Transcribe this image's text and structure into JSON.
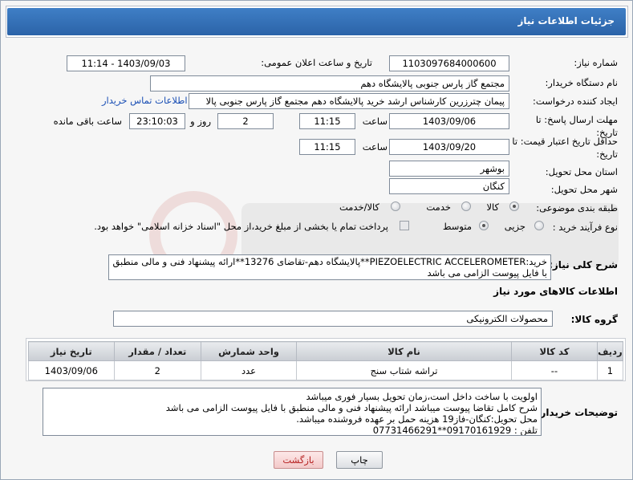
{
  "header": {
    "title": "جزئیات اطلاعات نیاز"
  },
  "labels": {
    "need_number": "شماره نیاز:",
    "announce_datetime": "تاریخ و ساعت اعلان عمومی:",
    "buyer_org": "نام دستگاه خریدار:",
    "requester": "ایجاد کننده درخواست:",
    "reply_deadline": "مهلت ارسال پاسخ: تا تاریخ:",
    "hour": "ساعت",
    "day_and": "روز و",
    "remaining": "ساعت باقی مانده",
    "price_validity": "حداقل تاریخ اعتبار قیمت: تا تاریخ:",
    "hour2": "ساعت",
    "province": "استان محل تحویل:",
    "city": "شهر محل تحویل:",
    "category": "طبقه بندی موضوعی:",
    "process_type": "نوع فرآیند خرید :",
    "summary": "شرح کلی نیاز:",
    "goods_info": "اطلاعات کالاهای مورد نیاز",
    "goods_group": "گروه کالا:",
    "buyer_notes": "توضیحات خریدار:"
  },
  "values": {
    "need_number": "1103097684000600",
    "announce_datetime": "1403/09/03 - 11:14",
    "buyer_org": "مجتمع گاز پارس جنوبی  پالایشگاه دهم",
    "requester": "پیمان چترزرین کارشناس ارشد خرید پالایشگاه دهم مجتمع گاز پارس جنوبی  پالا",
    "contact_link": "اطلاعات تماس خریدار",
    "reply_date": "1403/09/06",
    "reply_time": "11:15",
    "days": "2",
    "remaining_time": "23:10:03",
    "validity_date": "1403/09/20",
    "validity_time": "11:15",
    "province": "بوشهر",
    "city": "کنگان",
    "summary": "خرید:PIEZOELECTRIC ACCELEROMETER**پالایشگاه دهم-تقاضای 13276**ارائه پیشنهاد فنی و مالی منطبق با فایل پیوست الزامی می باشد",
    "goods_group": "محصولات الکترونیکی",
    "buyer_notes_lines": [
      "اولویت با ساخت داخل است،زمان تحویل بسیار فوری میباشد",
      "شرح کامل تقاضا پیوست میباشد ارائه پیشنهاد فنی و مالی منطبق با فایل پیوست الزامی می باشد",
      "محل تحویل:کنگان-فاز19 هزینه حمل بر عهده فروشنده میباشد.",
      "تلفن : 09170161929**07731466291"
    ]
  },
  "category_options": [
    {
      "label": "کالا",
      "checked": true
    },
    {
      "label": "خدمت",
      "checked": false
    },
    {
      "label": "کالا/خدمت",
      "checked": false
    }
  ],
  "process_options": [
    {
      "label": "جزیی",
      "checked": false
    },
    {
      "label": "متوسط",
      "checked": true
    }
  ],
  "treasury_note": "پرداخت تمام یا بخشی از مبلغ خرید،از محل \"اسناد خزانه اسلامی\" خواهد بود.",
  "table": {
    "headers": [
      "ردیف",
      "کد کالا",
      "نام کالا",
      "واحد شمارش",
      "تعداد / مقدار",
      "تاریخ نیاز"
    ],
    "rows": [
      [
        "1",
        "--",
        "تراشه شتاب سنج",
        "عدد",
        "2",
        "1403/09/06"
      ]
    ]
  },
  "buttons": {
    "print": "چاپ",
    "back": "بازگشت"
  },
  "colors": {
    "header": "#2b63a8",
    "link": "#1a4fb5",
    "back_text": "#b51f1f"
  }
}
